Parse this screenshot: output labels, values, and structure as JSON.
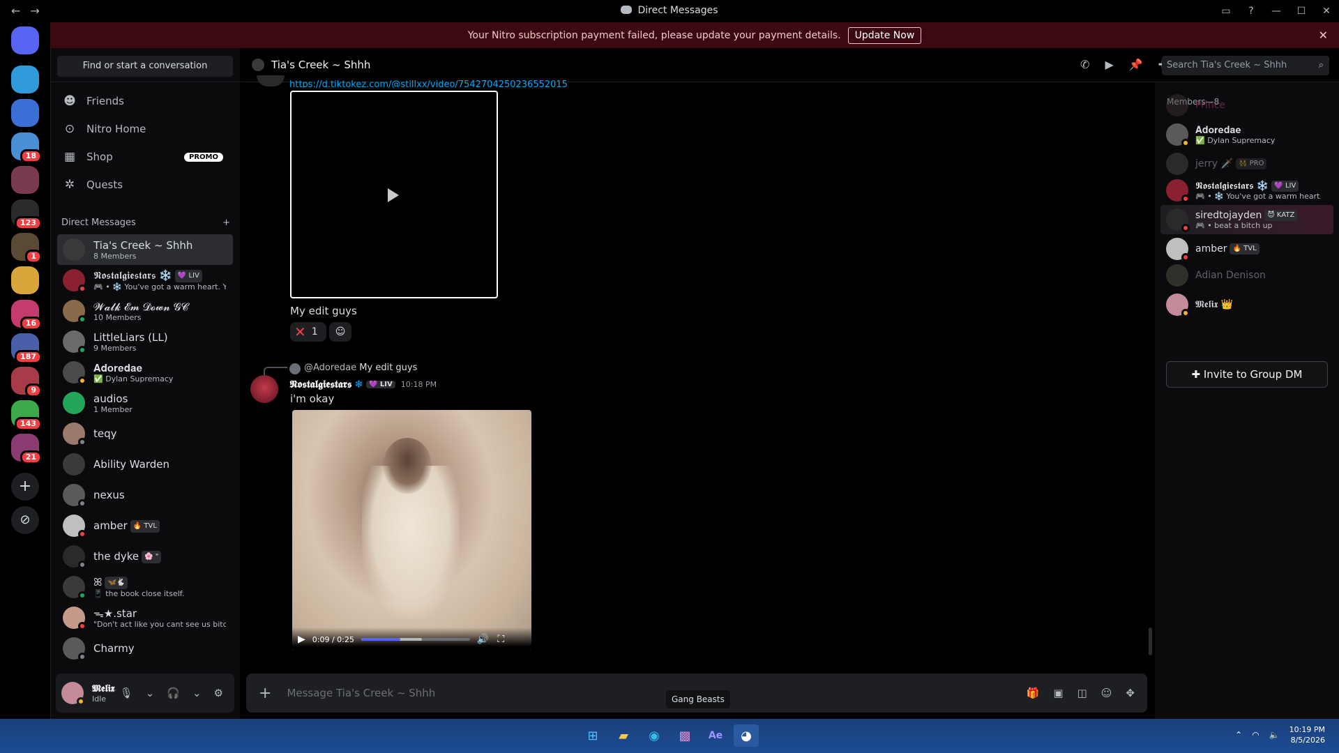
{
  "window": {
    "title": "Direct Messages"
  },
  "banner": {
    "text": "Your Nitro subscription payment failed, please update your payment details.",
    "button": "Update Now"
  },
  "servers": [
    {
      "color": "#5865f2",
      "badge": ""
    },
    {
      "color": "#2f9bd9",
      "badge": ""
    },
    {
      "color": "#3b6fd6",
      "badge": ""
    },
    {
      "color": "#4a8fd6",
      "badge": "18"
    },
    {
      "color": "#7a3b52",
      "badge": ""
    },
    {
      "color": "#2a2a2a",
      "badge": "123"
    },
    {
      "color": "#5a4a35",
      "badge": "1"
    },
    {
      "color": "#d9a63b",
      "badge": ""
    },
    {
      "color": "#c43b6f",
      "badge": "16"
    },
    {
      "color": "#4a5fa8",
      "badge": "187"
    },
    {
      "color": "#a83b4a",
      "badge": "9"
    },
    {
      "color": "#3ba84a",
      "badge": "143"
    },
    {
      "color": "#8a3b6f",
      "badge": "21"
    }
  ],
  "dm": {
    "find": "Find or start a conversation",
    "nav": [
      {
        "label": "Friends"
      },
      {
        "label": "Nitro Home"
      },
      {
        "label": "Shop",
        "badge": "PROMO"
      },
      {
        "label": "Quests"
      }
    ],
    "header": "Direct Messages",
    "rows": [
      {
        "name": "Tia's Creek ~ Shhh",
        "sub": "8 Members",
        "color": "#3a3a3a",
        "status": ""
      },
      {
        "name": "𝕹𝖔𝖘𝖙𝖆𝖑𝖌𝖎𝖊𝖘𝖙𝖆𝖗𝖘 ❄️",
        "tag": "💜 LIV",
        "sub": "🎮 • ❄️ You've got a warm heart. Yo...",
        "color": "#8a2030",
        "status": "#f23f43"
      },
      {
        "name": "𝓦𝓪𝓵𝓴 𝓔𝓶 𝓓𝓸𝔀𝓷 𝓖𝓒",
        "sub": "10 Members",
        "color": "#8a6a4a",
        "status": "#23a55a"
      },
      {
        "name": "LittleLiars (LL)",
        "sub": "9 Members",
        "color": "#6a6a6a",
        "status": "#23a55a"
      },
      {
        "name": "𝐀𝐝𝐨𝐫𝐞𝐝𝐚𝐞",
        "sub": "✅ Dylan Supremacy",
        "color": "#4a4a4a",
        "status": "#f0b232"
      },
      {
        "name": "audios",
        "sub": "1 Member",
        "color": "#23a55a",
        "status": ""
      },
      {
        "name": "teqy",
        "sub": "",
        "color": "#9a7a6a",
        "status": "#80848e"
      },
      {
        "name": "Ability Warden",
        "sub": "",
        "color": "#3a3a3a",
        "status": ""
      },
      {
        "name": "nexus",
        "sub": "",
        "color": "#5a5a5a",
        "status": "#80848e"
      },
      {
        "name": "amber",
        "tag": "🔥 TVL",
        "sub": "",
        "color": "#bfbfbf",
        "status": "#f23f43"
      },
      {
        "name": "the dyke",
        "tag": "🌸 \"",
        "sub": "",
        "color": "#2a2a2a",
        "status": "#80848e"
      },
      {
        "name": "ꕤ",
        "tag": "🦋🐇",
        "sub": "📱 the book close itself.",
        "color": "#3a3a3a",
        "status": "#23a55a"
      },
      {
        "name": "ᯓ★.star",
        "sub": "\"Don't act like you cant see us bitch\"",
        "color": "#c49a8a",
        "status": "#f23f43"
      },
      {
        "name": "Charmy",
        "sub": "",
        "color": "#5a5a5a",
        "status": "#80848e"
      }
    ],
    "user": {
      "name": "𝕸𝖊𝖑𝖎𝖝",
      "status": "Idle"
    }
  },
  "chat": {
    "channel": "Tia's Creek ~ Shhh",
    "search_placeholder": "Search Tia's Creek ~ Shhh",
    "link": "https://d.tiktokez.com/@stillxx/video/7542704250236552015",
    "caption": "My edit guys",
    "reaction_count": "1",
    "reply_author": "@Adoredae",
    "reply_text": "My edit guys",
    "author": "𝕹𝖔𝖘𝖙𝖆𝖑𝖌𝖎𝖊𝖘𝖙𝖆𝖗𝖘",
    "author_tag": "💜 LIV",
    "time": "10:18 PM",
    "message": "i'm okay",
    "video": {
      "time": "0:09 / 0:25",
      "progress": 0.36,
      "buffered": 0.56
    },
    "composer_placeholder": "Message Tia's Creek ~ Shhh",
    "tooltip": "Gang Beasts"
  },
  "members": {
    "header": "Members—8",
    "rows": [
      {
        "name": "Prince",
        "sub": "",
        "color": "#4a3a3a",
        "name_color": "#a8336a",
        "dim": true,
        "status": ""
      },
      {
        "name": "𝐀𝐝𝐨𝐫𝐞𝐝𝐚𝐞",
        "sub": "✅ Dylan Supremacy",
        "color": "#5a5a5a",
        "name_color": "#dbdee1",
        "dim": false,
        "status": "#f0b232"
      },
      {
        "name": "jerry 🗡️",
        "tag": "👯 PRO",
        "sub": "",
        "color": "#5a5a5a",
        "name_color": "#949ba4",
        "dim": true,
        "status": ""
      },
      {
        "name": "𝕹𝖔𝖘𝖙𝖆𝖑𝖌𝖎𝖊𝖘𝖙𝖆𝖗𝖘 ❄️",
        "tag": "💜 LIV",
        "sub": "🎮 • ❄️ You've got a warm heart. ...",
        "color": "#8a2030",
        "name_color": "#f2f3f5",
        "dim": false,
        "status": "#f23f43"
      },
      {
        "name": "siredtojayden",
        "tag": "😈 KATZ",
        "sub": "🎮 • beat a bitch up",
        "color": "#2a2a2a",
        "name_color": "#dbdee1",
        "dim": false,
        "status": "#f23f43",
        "highlight": true
      },
      {
        "name": "amber",
        "tag": "🔥 TVL",
        "sub": "",
        "color": "#bfbfbf",
        "name_color": "#dbdee1",
        "dim": false,
        "status": "#f23f43"
      },
      {
        "name": "Adian Denison",
        "sub": "",
        "color": "#6a6a5a",
        "name_color": "#949ba4",
        "dim": true,
        "status": ""
      },
      {
        "name": "𝕸𝖊𝖑𝖎𝖝 👑",
        "sub": "",
        "color": "#c48a9a",
        "name_color": "#dbdee1",
        "dim": false,
        "status": "#f0b232"
      }
    ],
    "invite": "Invite to Group DM"
  },
  "taskbar": {
    "time": "10:19 PM",
    "date": "8/5/2026"
  }
}
